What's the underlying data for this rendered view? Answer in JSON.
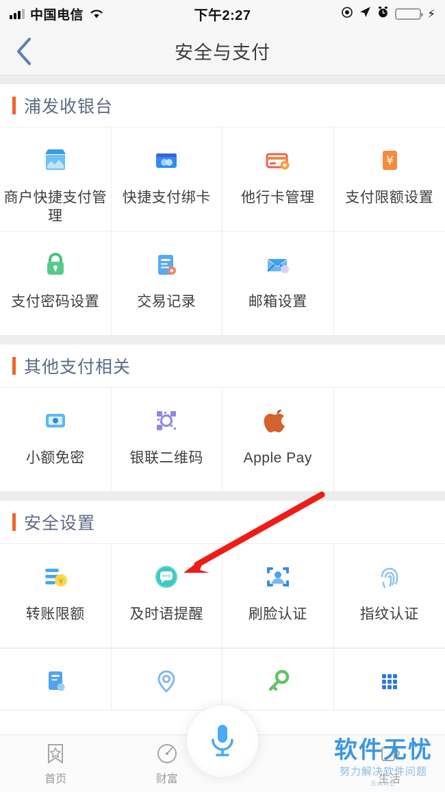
{
  "status_bar": {
    "carrier": "中国电信",
    "time": "下午2:27",
    "icons": [
      "signal-bars",
      "wifi-icon",
      "rotation-lock-icon",
      "location-arrow-icon",
      "alarm-clock-icon",
      "battery-icon",
      "charging-bolt-icon"
    ]
  },
  "nav": {
    "back_label": "‹",
    "title": "安全与支付"
  },
  "sections": [
    {
      "title": "浦发收银台",
      "items": [
        {
          "label": "商户快捷支付管理",
          "icon": "shop-icon"
        },
        {
          "label": "快捷支付绑卡",
          "icon": "card-bind-icon"
        },
        {
          "label": "他行卡管理",
          "icon": "other-bank-card-icon"
        },
        {
          "label": "支付限额设置",
          "icon": "payment-limit-icon"
        },
        {
          "label": "支付密码设置",
          "icon": "lock-icon"
        },
        {
          "label": "交易记录",
          "icon": "transaction-record-icon"
        },
        {
          "label": "邮箱设置",
          "icon": "email-icon"
        },
        {
          "label": "",
          "icon": ""
        }
      ]
    },
    {
      "title": "其他支付相关",
      "items": [
        {
          "label": "小额免密",
          "icon": "small-amount-icon"
        },
        {
          "label": "银联二维码",
          "icon": "qrcode-icon"
        },
        {
          "label": "Apple Pay",
          "icon": "apple-icon"
        },
        {
          "label": "",
          "icon": ""
        }
      ]
    },
    {
      "title": "安全设置",
      "items": [
        {
          "label": "转账限额",
          "icon": "transfer-limit-icon"
        },
        {
          "label": "及时语提醒",
          "icon": "message-alert-icon"
        },
        {
          "label": "刷脸认证",
          "icon": "face-id-icon"
        },
        {
          "label": "指纹认证",
          "icon": "fingerprint-icon"
        },
        {
          "label": "",
          "icon": "statement-icon"
        },
        {
          "label": "",
          "icon": "location-pin-icon"
        },
        {
          "label": "",
          "icon": "key-icon"
        },
        {
          "label": "",
          "icon": "keypad-icon"
        }
      ]
    }
  ],
  "tabbar": {
    "tabs": [
      {
        "label": "首页",
        "icon": "home-bookmark-icon"
      },
      {
        "label": "财富",
        "icon": "wealth-gauge-icon"
      },
      {
        "label": "生活",
        "icon": "life-cup-icon"
      }
    ],
    "fab_icon": "microphone-icon"
  },
  "watermark": {
    "main": "软件无忧",
    "sub": "努力解决软件问题",
    "tiny": "SAAZ"
  },
  "annotation": {
    "type": "red-arrow",
    "color": "#ee1c15",
    "points_to": "及时语提醒"
  },
  "colors": {
    "accent_bar": "#f2632a",
    "section_title": "#5b6b83",
    "page_bg": "#ffffff",
    "separator": "#ededed",
    "brand_blue": "#2a8fe0"
  }
}
